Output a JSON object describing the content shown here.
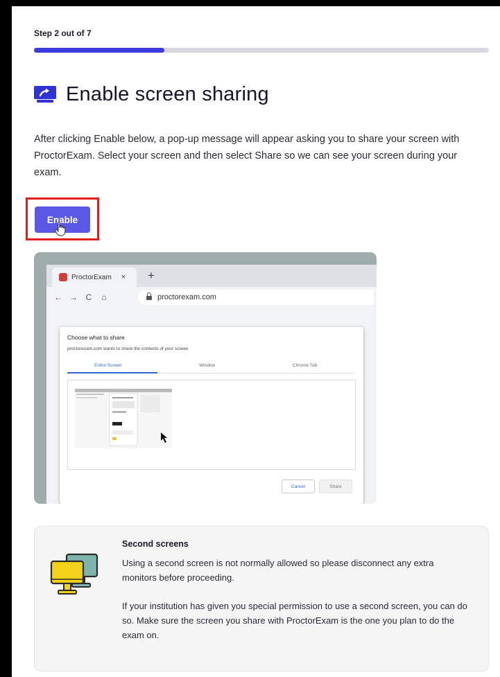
{
  "header": {
    "step_label": "Step 2 out of 7",
    "progress_fraction": 0.286,
    "title": "Enable screen sharing"
  },
  "intro_text": "After clicking Enable below, a pop-up message will appear asking you to share your screen with ProctorExam. Select your screen and then select Share so we can see your screen during your exam.",
  "enable_button": {
    "label": "Enable"
  },
  "illustration": {
    "tab_title": "ProctorExam",
    "tab_close": "×",
    "new_tab": "+",
    "nav_icons": [
      "←",
      "→",
      "C",
      "⌂"
    ],
    "url": "proctorexam.com",
    "dialog": {
      "title": "Choose what to share",
      "subtitle": "proctorexam.com wants to share the contents of your screen",
      "tabs": [
        "Entire Screen",
        "Window",
        "Chrome Tab"
      ],
      "cancel": "Cancel",
      "share": "Share"
    }
  },
  "info_card": {
    "heading": "Second screens",
    "paragraph1": "Using a second screen is not normally allowed so please disconnect any extra monitors before proceeding.",
    "paragraph2": "If your institution has given you special permission to use a second screen, you can do so. Make sure the screen you share with ProctorExam is the one you plan to do the exam on."
  },
  "colors": {
    "accent": "#3b3be0",
    "button": "#5b58e6",
    "highlight": "#e31c1c",
    "monitor_front": "#f3d21a",
    "monitor_back": "#7fb3ad"
  },
  "icons": {
    "title_icon": "screen-share-icon",
    "card_icon": "dual-monitor-icon",
    "cursor": "hand-pointer-icon"
  }
}
